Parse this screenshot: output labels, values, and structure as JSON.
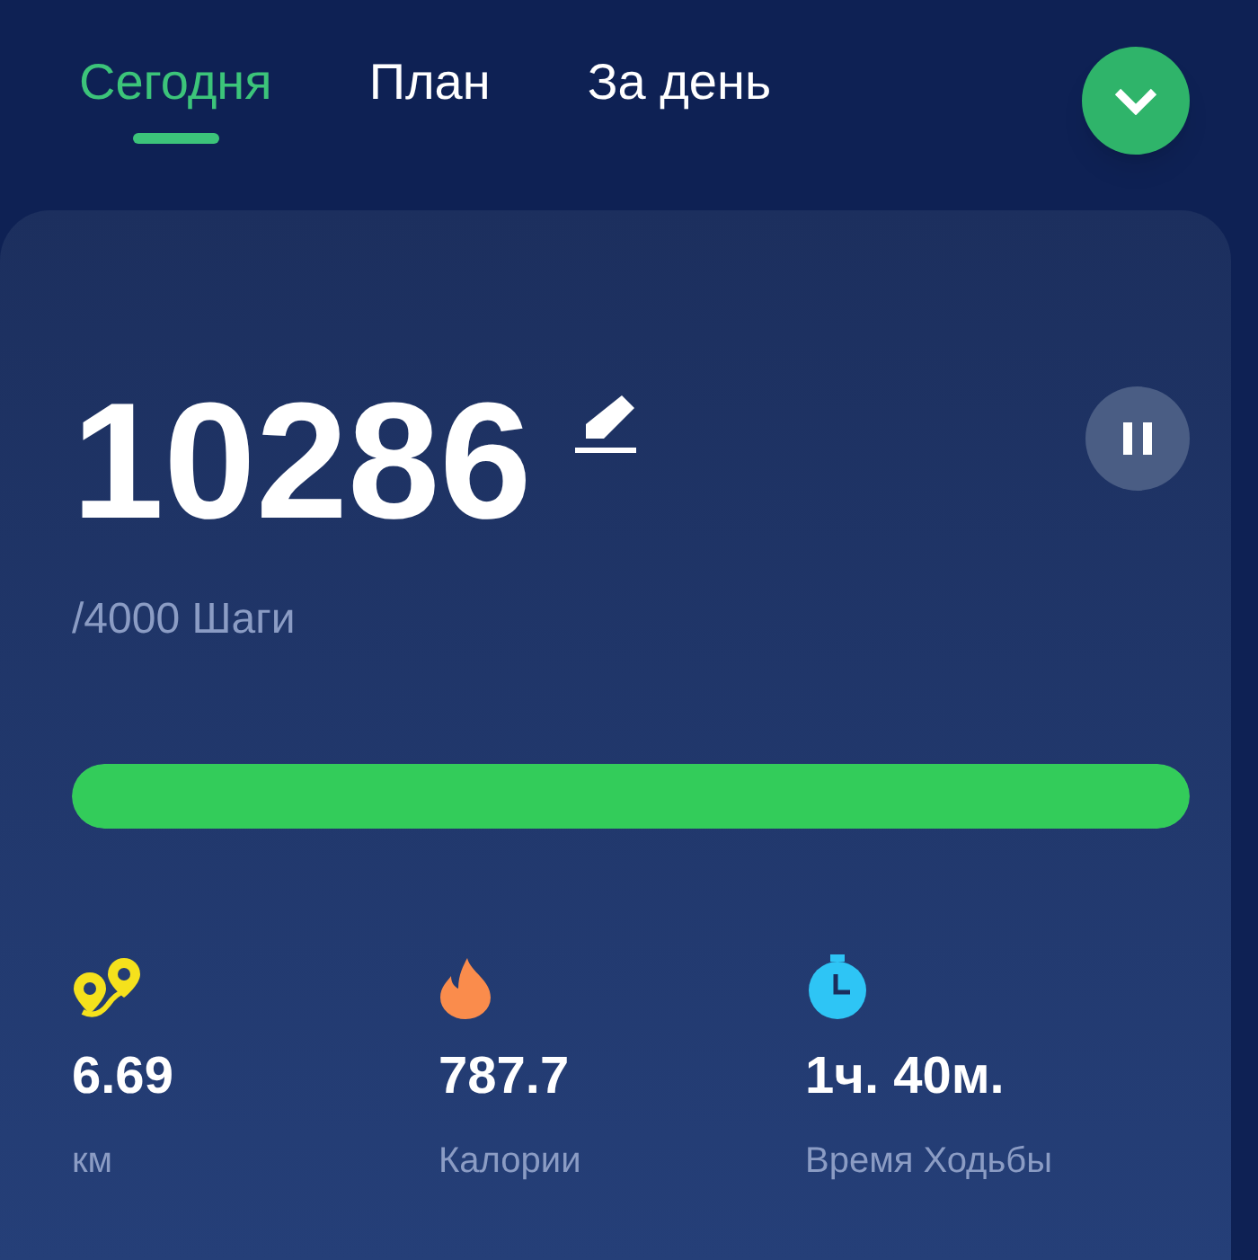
{
  "tabs": [
    {
      "label": "Сегодня",
      "selected": true
    },
    {
      "label": "План",
      "selected": false
    },
    {
      "label": "За день",
      "selected": false
    }
  ],
  "steps": {
    "value": "10286",
    "goal": "/4000 Шаги",
    "level": 1
  },
  "stats": [
    {
      "kind": "distance",
      "value": "6.69",
      "label": "км"
    },
    {
      "kind": "calories",
      "value": "787.7",
      "label": "Калории"
    },
    {
      "kind": "time",
      "value": "1ч. 40м.",
      "label": "Время Ходьбы"
    }
  ]
}
